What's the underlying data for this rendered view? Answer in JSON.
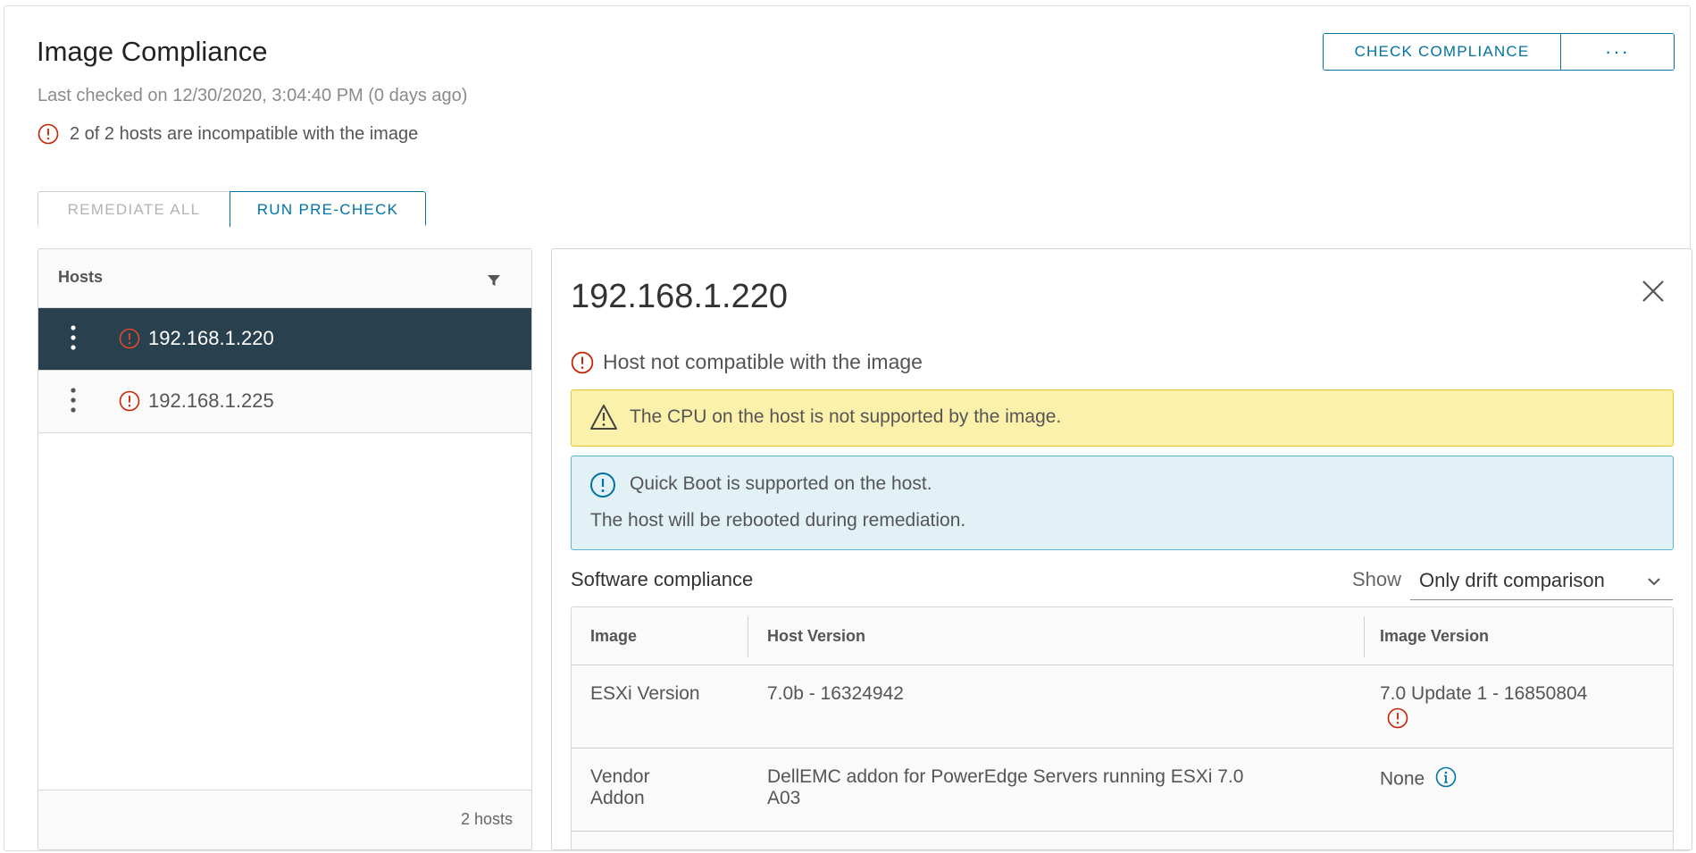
{
  "page": {
    "title": "Image Compliance",
    "last_checked": "Last checked on 12/30/2020, 3:04:40 PM (0 days ago)",
    "summary": "2 of 2 hosts are incompatible with the image",
    "check_compliance_label": "CHECK COMPLIANCE",
    "more_label": "···",
    "remediate_all_label": "REMEDIATE ALL",
    "run_precheck_label": "RUN PRE-CHECK"
  },
  "hosts": {
    "header": "Hosts",
    "items": [
      {
        "name": "192.168.1.220",
        "selected": true
      },
      {
        "name": "192.168.1.225",
        "selected": false
      }
    ],
    "footer_count": "2 hosts"
  },
  "detail": {
    "title": "192.168.1.220",
    "status": "Host not compatible with the image",
    "warning": "The CPU on the host is not supported by the image.",
    "info_line1": "Quick Boot is supported on the host.",
    "info_line2": "The host will be rebooted during remediation.",
    "software_title": "Software compliance",
    "show_label": "Show",
    "show_value": "Only drift comparison",
    "columns": [
      "Image",
      "Host Version",
      "Image Version"
    ],
    "rows": [
      {
        "image": "ESXi Version",
        "host_version": "7.0b - 16324942",
        "image_version": "7.0 Update 1 - 16850804"
      },
      {
        "image_line1": "Vendor",
        "image_line2": "Addon",
        "host_line1": "DellEMC addon for PowerEdge Servers running ESXi 7.0",
        "host_line2": "A03",
        "image_version": "None"
      }
    ]
  },
  "colors": {
    "accent": "#0072a3",
    "error": "#c92100",
    "selected_row": "#29414e",
    "warning_bg": "#fcf1aa",
    "info_bg": "#e1f1f6"
  },
  "icons": [
    "error-circle-icon",
    "filter-icon",
    "kebab-menu-icon",
    "close-icon",
    "warning-triangle-icon",
    "info-circle-icon",
    "chevron-down-icon"
  ]
}
